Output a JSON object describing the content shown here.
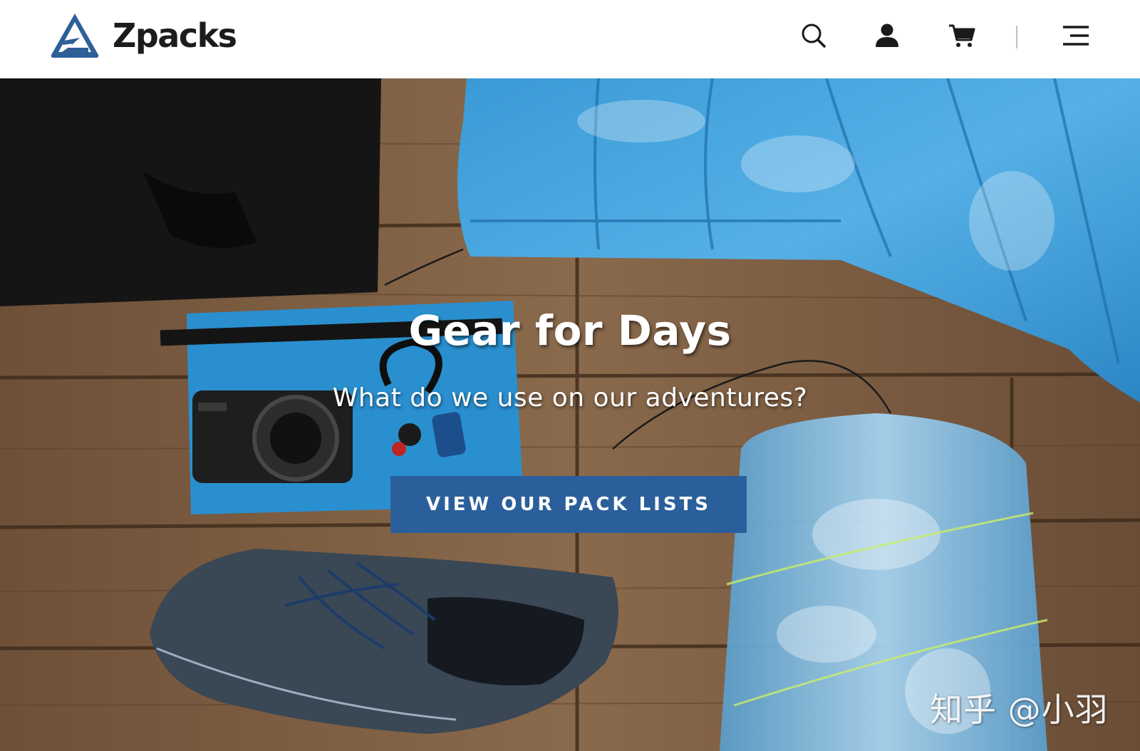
{
  "header": {
    "brand_name": "Zpacks",
    "icons": [
      "search-icon",
      "account-icon",
      "cart-icon",
      "menu-icon"
    ]
  },
  "hero": {
    "title": "Gear for Days",
    "subtitle": "What do we use on our adventures?",
    "cta_label": "VIEW OUR PACK LISTS",
    "watermark": "知乎 @小羽"
  },
  "colors": {
    "cta_background": "#2b5f9b",
    "logo_blue": "#2e5f97",
    "header_background": "#ffffff"
  }
}
